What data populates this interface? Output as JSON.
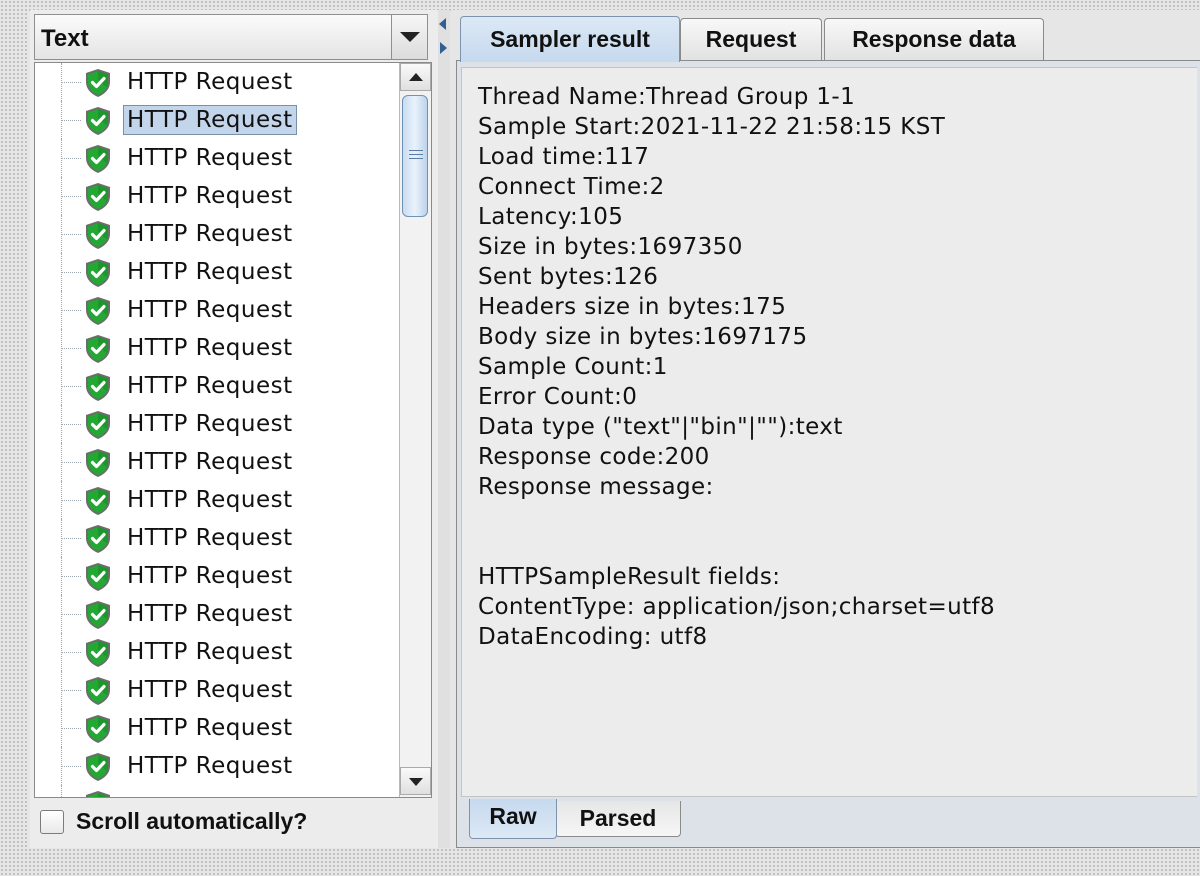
{
  "left_panel": {
    "render_select": {
      "value": "Text"
    },
    "tree_items": [
      {
        "label": "HTTP Request",
        "status": "success",
        "selected": false
      },
      {
        "label": "HTTP Request",
        "status": "success",
        "selected": true
      },
      {
        "label": "HTTP Request",
        "status": "success",
        "selected": false
      },
      {
        "label": "HTTP Request",
        "status": "success",
        "selected": false
      },
      {
        "label": "HTTP Request",
        "status": "success",
        "selected": false
      },
      {
        "label": "HTTP Request",
        "status": "success",
        "selected": false
      },
      {
        "label": "HTTP Request",
        "status": "success",
        "selected": false
      },
      {
        "label": "HTTP Request",
        "status": "success",
        "selected": false
      },
      {
        "label": "HTTP Request",
        "status": "success",
        "selected": false
      },
      {
        "label": "HTTP Request",
        "status": "success",
        "selected": false
      },
      {
        "label": "HTTP Request",
        "status": "success",
        "selected": false
      },
      {
        "label": "HTTP Request",
        "status": "success",
        "selected": false
      },
      {
        "label": "HTTP Request",
        "status": "success",
        "selected": false
      },
      {
        "label": "HTTP Request",
        "status": "success",
        "selected": false
      },
      {
        "label": "HTTP Request",
        "status": "success",
        "selected": false
      },
      {
        "label": "HTTP Request",
        "status": "success",
        "selected": false
      },
      {
        "label": "HTTP Request",
        "status": "success",
        "selected": false
      },
      {
        "label": "HTTP Request",
        "status": "success",
        "selected": false
      },
      {
        "label": "HTTP Request",
        "status": "success",
        "selected": false
      },
      {
        "label": "",
        "status": "success",
        "selected": false
      }
    ],
    "auto_scroll": {
      "label": "Scroll automatically?",
      "checked": false
    }
  },
  "right_panel": {
    "tabs": [
      {
        "label": "Sampler result",
        "active": true
      },
      {
        "label": "Request",
        "active": false
      },
      {
        "label": "Response data",
        "active": false
      }
    ],
    "sampler_result_lines": [
      "Thread Name:Thread Group 1-1",
      "Sample Start:2021-11-22 21:58:15 KST",
      "Load time:117",
      "Connect Time:2",
      "Latency:105",
      "Size in bytes:1697350",
      "Sent bytes:126",
      "Headers size in bytes:175",
      "Body size in bytes:1697175",
      "Sample Count:1",
      "Error Count:0",
      "Data type (\"text\"|\"bin\"|\"\"):text",
      "Response code:200",
      "Response message:",
      "",
      "",
      "HTTPSampleResult fields:",
      "ContentType: application/json;charset=utf8",
      "DataEncoding: utf8"
    ],
    "bottom_tabs": [
      {
        "label": "Raw",
        "active": true
      },
      {
        "label": "Parsed",
        "active": false
      }
    ]
  },
  "colors": {
    "selection_bg": "#c3d5ea",
    "active_tab_bg": "#c6d9ee",
    "success_icon": "#1e9e2e"
  },
  "icons": {
    "tree_item_status": "green-shield-check-icon",
    "dropdown": "chevron-down-icon",
    "scroll_up": "arrow-up-icon",
    "scroll_down": "arrow-down-icon"
  }
}
